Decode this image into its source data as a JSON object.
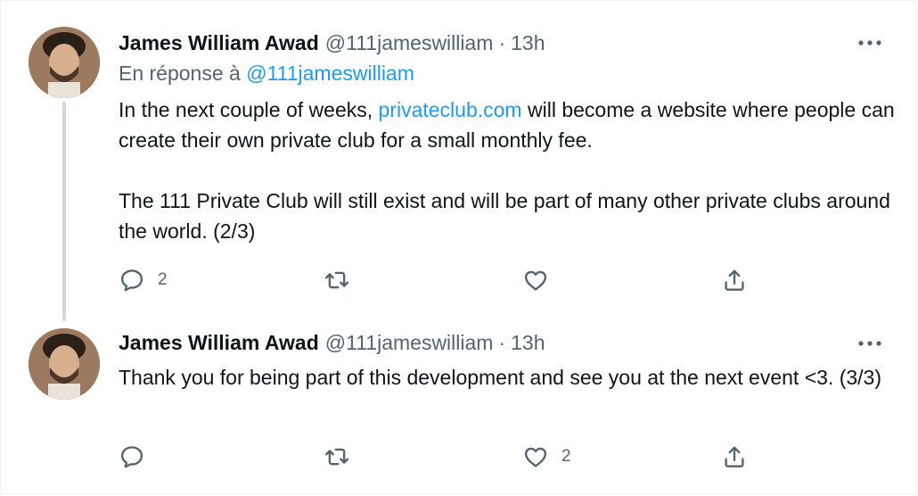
{
  "tweets": [
    {
      "author_name": "James William Awad",
      "author_handle": "@111jameswilliam",
      "separator": "·",
      "time": "13h",
      "reply_prefix": "En réponse à",
      "reply_handle": "@111jameswilliam",
      "text_part1": "In the next couple of weeks, ",
      "text_link": "privateclub.com",
      "text_part2": " will become a website where people can create their own private club for a small monthly fee.",
      "text_para2": "The 111 Private Club will still exist and will be part of many other private clubs around the world. (2/3)",
      "reply_count": "2",
      "retweet_count": "",
      "like_count": ""
    },
    {
      "author_name": "James William Awad",
      "author_handle": "@111jameswilliam",
      "separator": "·",
      "time": "13h",
      "text": "Thank you for being part of this development and see you at the next event <3. (3/3)",
      "reply_count": "",
      "retweet_count": "",
      "like_count": "2"
    }
  ],
  "icons": {
    "more": "more-horizontal-icon",
    "reply": "speech-bubble-icon",
    "retweet": "retweet-arrows-icon",
    "like": "heart-icon",
    "share": "share-upload-icon"
  },
  "colors": {
    "text_primary": "#0f1419",
    "text_secondary": "#536471",
    "link": "#1d9bf0",
    "thread_line": "#cfd9de"
  }
}
